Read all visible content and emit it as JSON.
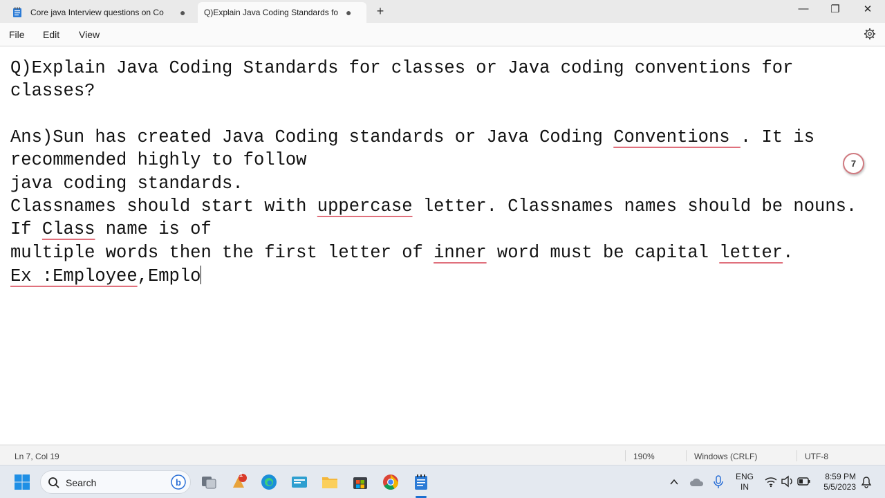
{
  "tabs": [
    {
      "label": "Core java Interview questions on Co",
      "modified": "●"
    },
    {
      "label": "Q)Explain Java Coding Standards fo",
      "modified": "●"
    }
  ],
  "window": {
    "new_tab": "+",
    "minimize": "—",
    "maximize": "❐",
    "close": "✕"
  },
  "menu": {
    "file": "File",
    "edit": "Edit",
    "view": "View"
  },
  "editor": {
    "badge": "7"
  },
  "status": {
    "position": "Ln 7, Col 19",
    "zoom": "190%",
    "line_ending": "Windows (CRLF)",
    "encoding": "UTF-8"
  },
  "taskbar": {
    "search_label": "Search",
    "notification_count": "1",
    "lang_top": "ENG",
    "lang_bottom": "IN",
    "time": "8:59 PM",
    "date": "5/5/2023"
  },
  "colors": {
    "accent": "#1a6fd0",
    "spell_underline": "#e0707c"
  },
  "text": {
    "l1": "Q)Explain Java Coding Standards for classes or Java coding conventions for",
    "l2": "classes?",
    "l3a": "Ans)Sun has created Java Coding standards or Java Coding ",
    "l3b": "Conventions ",
    "l3c": ". It is",
    "l4": "recommended highly to follow",
    "l5": "java coding standards.",
    "l6a": "Classnames should start with ",
    "l6b": "uppercase",
    "l6c": " letter. Classnames names should be nouns.",
    "l7a": "If ",
    "l7b": "Class",
    "l7c": " name is of",
    "l8a": "multiple words then the first letter of ",
    "l8b": "inner",
    "l8c": " word must be capital ",
    "l8d": "letter",
    "l8e": ".",
    "l9a": "Ex :Employee",
    "l9b": ",Emplo"
  }
}
